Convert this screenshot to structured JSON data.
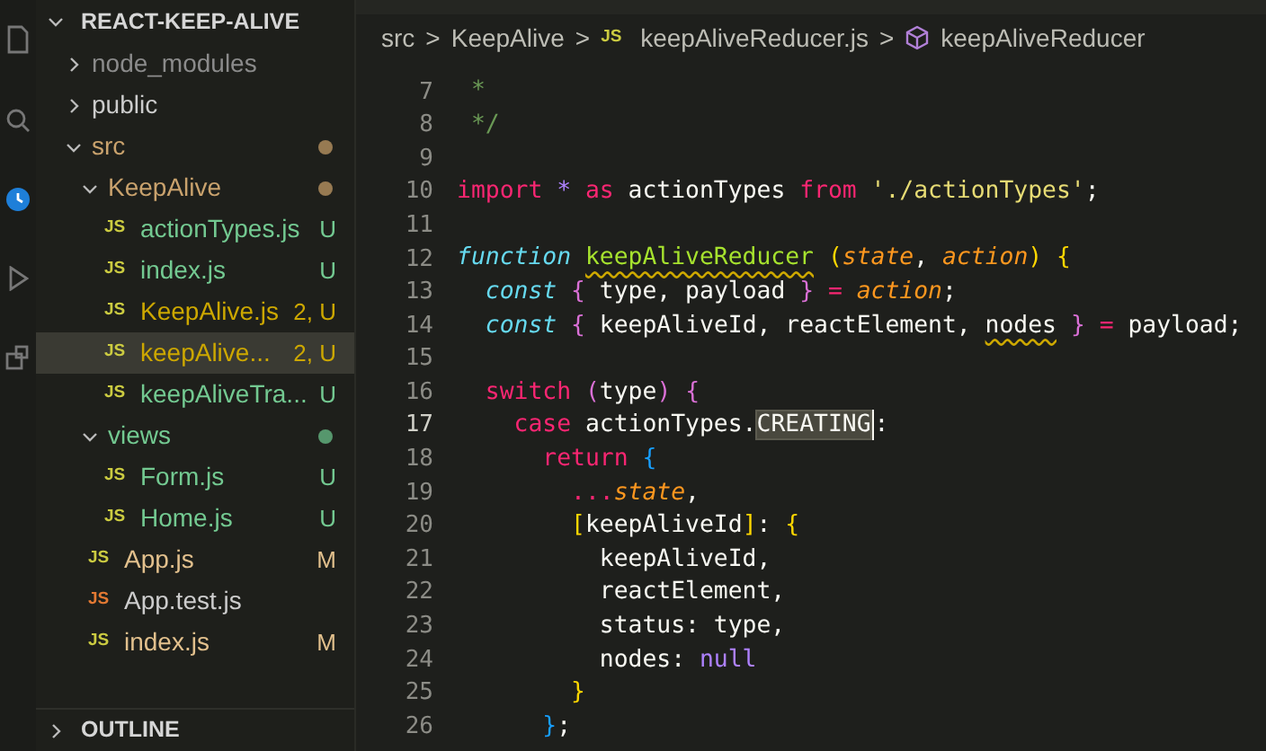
{
  "explorer": {
    "title": "REACT-KEEP-ALIVE",
    "expanded": true,
    "tree": [
      {
        "label": "node_modules",
        "kind": "folder",
        "expanded": false,
        "color": "#8b8b8b",
        "selected": false
      },
      {
        "label": "public",
        "kind": "folder",
        "expanded": false,
        "color": "#cccccc",
        "selected": false
      },
      {
        "label": "src",
        "kind": "folder",
        "expanded": true,
        "color": "#c9a26d",
        "dot": true,
        "selected": false,
        "children": [
          {
            "label": "KeepAlive",
            "kind": "folder",
            "expanded": true,
            "color": "#c9a26d",
            "dot": true,
            "selected": false,
            "children": [
              {
                "label": "actionTypes.js",
                "kind": "file",
                "badge": "JS",
                "color": "#73c991",
                "status": "U",
                "selected": false
              },
              {
                "label": "index.js",
                "kind": "file",
                "badge": "JS",
                "color": "#73c991",
                "status": "U",
                "selected": false
              },
              {
                "label": "KeepAlive.js",
                "kind": "file",
                "badge": "JS",
                "color": "#cca700",
                "status": "2, U",
                "selected": false
              },
              {
                "label": "keepAlive...",
                "kind": "file",
                "badge": "JS",
                "color": "#cca700",
                "status": "2, U",
                "selected": true
              },
              {
                "label": "keepAliveTra...",
                "kind": "file",
                "badge": "JS",
                "color": "#73c991",
                "status": "U",
                "selected": false
              }
            ]
          },
          {
            "label": "views",
            "kind": "folder",
            "expanded": true,
            "color": "#73c991",
            "dot": true,
            "selected": false,
            "children": [
              {
                "label": "Form.js",
                "kind": "file",
                "badge": "JS",
                "color": "#73c991",
                "status": "U",
                "selected": false
              },
              {
                "label": "Home.js",
                "kind": "file",
                "badge": "JS",
                "color": "#73c991",
                "status": "U",
                "selected": false
              }
            ]
          },
          {
            "label": "App.js",
            "kind": "file",
            "badge": "JS",
            "color": "#e2c08d",
            "status": "M",
            "selected": false
          },
          {
            "label": "App.test.js",
            "kind": "test-file",
            "badge": "JS",
            "color": "#cccccc",
            "selected": false
          },
          {
            "label": "index.js",
            "kind": "file",
            "badge": "JS",
            "color": "#e2c08d",
            "status": "M",
            "selected": false
          }
        ]
      }
    ],
    "outline": {
      "title": "OUTLINE",
      "expanded": false
    }
  },
  "breadcrumb": {
    "separator": ">",
    "items": [
      {
        "label": "src",
        "kind": "folder"
      },
      {
        "label": "KeepAlive",
        "kind": "folder"
      },
      {
        "label": "keepAliveReducer.js",
        "kind": "file",
        "badge": "JS"
      },
      {
        "label": "keepAliveReducer",
        "kind": "symbol"
      }
    ]
  },
  "code": [
    {
      "n": "7",
      "tokens": [
        {
          "t": " *",
          "kind": "comment"
        }
      ]
    },
    {
      "n": "8",
      "tokens": [
        {
          "t": " */",
          "kind": "comment"
        }
      ]
    },
    {
      "n": "9"
    },
    {
      "n": "10",
      "tokens": [
        {
          "t": "import ",
          "kind": "keyword"
        },
        {
          "t": "* ",
          "kind": "operator"
        },
        {
          "t": "as ",
          "kind": "keyword"
        },
        {
          "t": "actionTypes "
        },
        {
          "t": "from ",
          "kind": "keyword"
        },
        {
          "t": "'./actionTypes'",
          "kind": "string"
        },
        {
          "t": ";"
        }
      ]
    },
    {
      "n": "11"
    },
    {
      "n": "12",
      "tokens": [
        {
          "t": "function ",
          "kind": "storage"
        },
        {
          "t": "keepAliveReducer",
          "kind": "function",
          "squiggle": true
        },
        {
          "t": " (",
          "kind": "bracket1"
        },
        {
          "t": "state",
          "kind": "param"
        },
        {
          "t": ", "
        },
        {
          "t": "action",
          "kind": "param"
        },
        {
          "t": ") {",
          "kind": "bracket1"
        }
      ]
    },
    {
      "n": "13",
      "tokens": [
        {
          "t": "  const ",
          "kind": "storage"
        },
        {
          "t": "{",
          "kind": "bracket2"
        },
        {
          "t": " type, payload "
        },
        {
          "t": "}",
          "kind": "bracket2"
        },
        {
          "t": " = ",
          "kind": "keyword"
        },
        {
          "t": "action",
          "kind": "param"
        },
        {
          "t": ";"
        }
      ]
    },
    {
      "n": "14",
      "tokens": [
        {
          "t": "  const ",
          "kind": "storage"
        },
        {
          "t": "{",
          "kind": "bracket2"
        },
        {
          "t": " keepAliveId, reactElement, "
        },
        {
          "t": "nodes",
          "kind": "plain",
          "squiggle": true
        },
        {
          "t": " }",
          "kind": "bracket2"
        },
        {
          "t": " = ",
          "kind": "keyword"
        },
        {
          "t": "payload;"
        }
      ]
    },
    {
      "n": "15"
    },
    {
      "n": "16",
      "tokens": [
        {
          "t": "  switch ",
          "kind": "keyword"
        },
        {
          "t": "(",
          "kind": "bracket2"
        },
        {
          "t": "type"
        },
        {
          "t": ") {",
          "kind": "bracket2"
        }
      ]
    },
    {
      "n": "17",
      "current": true,
      "tokens": [
        {
          "t": "    case ",
          "kind": "keyword"
        },
        {
          "t": "actionTypes."
        },
        {
          "t": "CREATING",
          "selected": true
        },
        {
          "t": ":"
        }
      ]
    },
    {
      "n": "18",
      "tokens": [
        {
          "t": "      return ",
          "kind": "keyword"
        },
        {
          "t": "{",
          "kind": "bracket3"
        }
      ]
    },
    {
      "n": "19",
      "tokens": [
        {
          "t": "        ...",
          "kind": "keyword"
        },
        {
          "t": "state",
          "kind": "param"
        },
        {
          "t": ","
        }
      ]
    },
    {
      "n": "20",
      "tokens": [
        {
          "t": "        [",
          "kind": "bracket1"
        },
        {
          "t": "keepAliveId"
        },
        {
          "t": "]",
          "kind": "bracket1"
        },
        {
          "t": ": "
        },
        {
          "t": "{",
          "kind": "bracket1"
        }
      ]
    },
    {
      "n": "21",
      "tokens": [
        {
          "t": "          keepAliveId,"
        }
      ]
    },
    {
      "n": "22",
      "tokens": [
        {
          "t": "          reactElement,"
        }
      ]
    },
    {
      "n": "23",
      "tokens": [
        {
          "t": "          status: type,"
        }
      ]
    },
    {
      "n": "24",
      "tokens": [
        {
          "t": "          nodes: "
        },
        {
          "t": "null",
          "kind": "constant"
        }
      ]
    },
    {
      "n": "25",
      "tokens": [
        {
          "t": "        }",
          "kind": "bracket1"
        }
      ]
    },
    {
      "n": "26",
      "tokens": [
        {
          "t": "      }",
          "kind": "bracket3"
        },
        {
          "t": ";"
        }
      ]
    }
  ]
}
